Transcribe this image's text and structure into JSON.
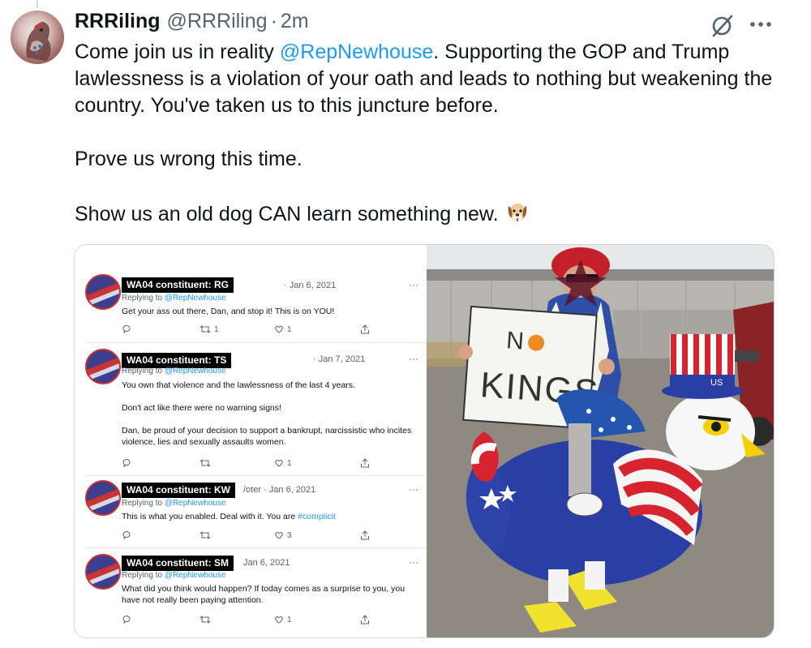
{
  "tweet": {
    "name": "RRRiling",
    "handle": "@RRRiling",
    "separator": "·",
    "time": "2m",
    "line1_pre": "Come join us in reality ",
    "mention": "@RepNewhouse",
    "line1_post": ".  Supporting the GOP and Trump lawlessness is a violation of your oath and leads to nothing but weakening the country.  You've taken us to this juncture before.",
    "line2": "Prove us wrong this time.",
    "line3": "Show us an old dog CAN learn something new."
  },
  "icons": {
    "grok": "grok-icon",
    "more": "more-icon",
    "emoji": "dog-face-emoji"
  },
  "screenshot": {
    "replying_label": "Replying to",
    "replying_to": "@RepNewhouse",
    "tweets": [
      {
        "name": "WA04 constituent: RG",
        "date": "· Jan 6, 2021",
        "more": "···",
        "text": [
          "Get your ass out there, Dan, and stop it! This is on YOU!"
        ],
        "retweets": "1",
        "likes": "1"
      },
      {
        "name": "WA04 constituent: TS",
        "date": "· Jan 7, 2021",
        "more": "···",
        "text": [
          "You own that violence and the lawlessness of the last 4 years.",
          "Don't act like there were no warning signs!",
          "Dan, be proud of your decision to support a bankrupt, narcissistic who incites violence,  lies and sexually assaults women."
        ],
        "retweets": "",
        "likes": "1"
      },
      {
        "name": "WA04 constituent: KW",
        "date": "/oter · Jan 6, 2021",
        "more": "···",
        "text_pre": "This is what you enabled. Deal with it. You are ",
        "hashtag": "#complicit",
        "retweets": "",
        "likes": "3"
      },
      {
        "name": "WA04 constituent: SM",
        "date": "Jan 6, 2021",
        "more": "···",
        "text": [
          "What did you think would happen? If today comes as a surprise to you, you have not really been paying attention."
        ],
        "retweets": "",
        "likes": "1"
      }
    ]
  },
  "photo": {
    "sign_line1_n": "N",
    "sign_line2": "KINGS",
    "hat_text": "US"
  },
  "colors": {
    "link": "#1d9bf0",
    "text": "#0f1419",
    "secondary": "#536471"
  }
}
